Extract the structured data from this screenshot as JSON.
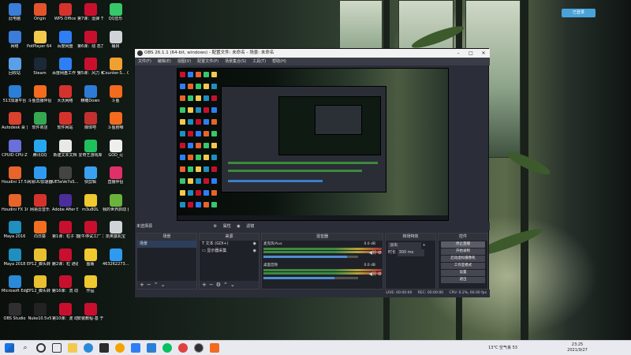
{
  "desktop": {
    "icons": [
      {
        "label": "此电脑",
        "color": "#3b7dd8"
      },
      {
        "label": "Origin",
        "color": "#e3542c"
      },
      {
        "label": "WPS Office",
        "color": "#d6322d"
      },
      {
        "label": "第7课：运弹 节点（bo...",
        "color": "#c8102e"
      },
      {
        "label": "QQ音乐",
        "color": "#37c86a"
      },
      {
        "label": "网络",
        "color": "#3b7dd8"
      },
      {
        "label": "PotPlayer 64 bit",
        "color": "#f2c94c"
      },
      {
        "label": "百度网盘",
        "color": "#2f7ef5"
      },
      {
        "label": "第6课：动 态力和布约",
        "color": "#c8102e"
      },
      {
        "label": "桶目",
        "color": "#d0d3d8"
      },
      {
        "label": "回收站",
        "color": "#5aa0e8"
      },
      {
        "label": "Steam",
        "color": "#1b2838"
      },
      {
        "label": "百度网盘工作 空间",
        "color": "#2f7ef5"
      },
      {
        "label": "第5课：风力 和涡流",
        "color": "#c8102e"
      },
      {
        "label": "Counter-S... Global Off...",
        "color": "#f0a030"
      },
      {
        "label": "513加速平台",
        "color": "#2b7fd6"
      },
      {
        "label": "斗鱼直播伴侣",
        "color": "#f46a1f"
      },
      {
        "label": "大沃网络",
        "color": "#d6322d"
      },
      {
        "label": "精確Down",
        "color": "#2e7bd6"
      },
      {
        "label": "斗鱼",
        "color": "#f46a1f"
      },
      {
        "label": "Autodesk 桌 面应用程序",
        "color": "#d9422d"
      },
      {
        "label": "软件商店",
        "color": "#35a852"
      },
      {
        "label": "软件网站",
        "color": "#d6322d"
      },
      {
        "label": "媒体吧",
        "color": "#c23030"
      },
      {
        "label": "斗鱼剧哪",
        "color": "#f46a1f"
      },
      {
        "label": "CPUID CPU-Z",
        "color": "#6b6fd8"
      },
      {
        "label": "腾讯QQ",
        "color": "#26a8f0"
      },
      {
        "label": "新建文本文档",
        "color": "#e8e8e8"
      },
      {
        "label": "爱奇艺游戏库",
        "color": "#20c05c"
      },
      {
        "label": "GOD_cj",
        "color": "#eeeeee"
      },
      {
        "label": "Houdini 17.5.425",
        "color": "#e8642b"
      },
      {
        "label": "网易UU加速器",
        "color": "#2e9bf0"
      },
      {
        "label": "UE5eVe7oS...",
        "color": "#444444"
      },
      {
        "label": "快剪辑",
        "color": "#3aa0f0"
      },
      {
        "label": "直播伴侣",
        "color": "#e02f6b"
      },
      {
        "label": "Houdini FX 16.5.268",
        "color": "#e8642b"
      },
      {
        "label": "网易云音乐",
        "color": "#d6322d"
      },
      {
        "label": "Adobe After Effects CC ...",
        "color": "#4b2d9b"
      },
      {
        "label": "m3u8DL",
        "color": "#f0c830"
      },
      {
        "label": "我的世界启动 器",
        "color": "#6bb33a"
      },
      {
        "label": "Maya 2016",
        "color": "#1f8fbf"
      },
      {
        "label": "向日葵",
        "color": "#f26f21"
      },
      {
        "label": "第1课：粒子 发射器",
        "color": "#c8102e"
      },
      {
        "label": "金牛停试工厂 发布",
        "color": "#c8102e"
      },
      {
        "label": "凯英露机宝",
        "color": "#d0d3d8"
      },
      {
        "label": "Maya 2018",
        "color": "#1f8fbf"
      },
      {
        "label": "EP12_脚头转 录像1",
        "color": "#e8c030"
      },
      {
        "label": "第2课：粒 通道",
        "color": "#c8102e"
      },
      {
        "label": "图版",
        "color": "#f0c830"
      },
      {
        "label": "463262273...",
        "color": "#2e9bf0"
      },
      {
        "label": "Microsoft Edge",
        "color": "#2a8ad8"
      },
      {
        "label": "EP12_脚头转 录像2",
        "color": "#e8c030"
      },
      {
        "label": "第16课：流 动粒子旋转",
        "color": "#c8102e"
      },
      {
        "label": "作品",
        "color": "#f0c830"
      },
      {
        "label": "",
        "color": "transparent"
      },
      {
        "label": "OBS Studio",
        "color": "#302e31"
      },
      {
        "label": "Nuke10.5v5",
        "color": "#222222"
      },
      {
        "label": "第10课：波 动水",
        "color": "#c8102e"
      },
      {
        "label": "安装教程-基 于Java的编辑器...",
        "color": "#c8102e"
      },
      {
        "label": "",
        "color": "transparent"
      }
    ]
  },
  "widget": {
    "label": "已登录"
  },
  "obs": {
    "title": "OBS 26.1.1 (64-bit, windows) - 配置文件: 未命名 - 场景: 未命名",
    "menu": [
      "文件(F)",
      "编辑(E)",
      "视图(V)",
      "配置文件(P)",
      "场景集合(S)",
      "工具(T)",
      "帮助(H)"
    ],
    "preview_bar": {
      "label": "未选择源",
      "props": "属性",
      "filters": "滤镜"
    },
    "scenes": {
      "header": "场景",
      "items": [
        "场景"
      ]
    },
    "sources": {
      "header": "来源",
      "items": [
        {
          "label": "文本 (GDI+)",
          "icon": "T"
        },
        {
          "label": "显示器采集",
          "icon": "▭"
        }
      ]
    },
    "mixer": {
      "header": "混音器",
      "channels": [
        {
          "name": "麦克风/Aux",
          "level": "0.0 dB",
          "fill": 0.88
        },
        {
          "name": "桌面音频",
          "level": "0.0 dB",
          "fill": 0.75
        }
      ]
    },
    "transitions": {
      "header": "转场特效",
      "type": "淡出",
      "duration_label": "时长",
      "duration": "300 ms"
    },
    "controls": {
      "header": "控件",
      "buttons": [
        "停止直播",
        "开始录制",
        "启动虚拟摄像机",
        "工作室模式",
        "设置",
        "退出"
      ]
    },
    "status": {
      "live": "LIVE: 00:00:00",
      "rec": "REC: 00:00:00",
      "cpu": "CPU: 0.2%, 60.00 fps"
    }
  },
  "taskbar": {
    "weather": "13°C 空气良 53",
    "time": "23:25",
    "date": "2021/9/27"
  }
}
